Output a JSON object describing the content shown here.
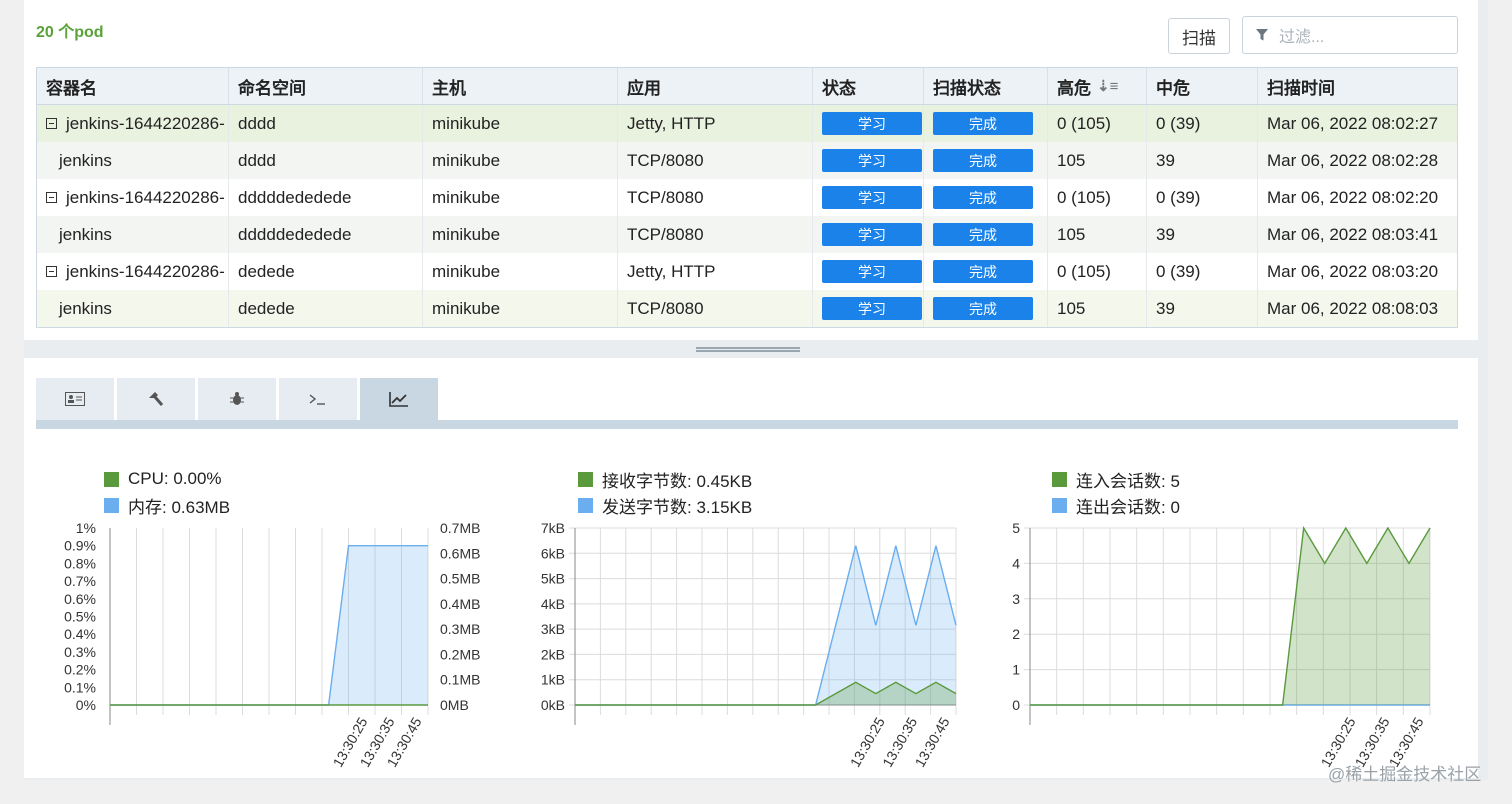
{
  "top": {
    "pod_count": "20 个pod",
    "scan_label": "扫描",
    "filter_placeholder": "过滤..."
  },
  "table": {
    "headers": [
      "容器名",
      "命名空间",
      "主机",
      "应用",
      "状态",
      "扫描状态",
      "高危",
      "中危",
      "扫描时间"
    ],
    "rows": [
      {
        "name": "jenkins-1644220286-",
        "ns": "dddd",
        "host": "minikube",
        "app": "Jetty, HTTP",
        "status": "学习",
        "scan": "完成",
        "high": "0 (105)",
        "mid": "0 (39)",
        "time": "Mar 06, 2022 08:02:27"
      },
      {
        "name": "jenkins",
        "ns": "dddd",
        "host": "minikube",
        "app": "TCP/8080",
        "status": "学习",
        "scan": "完成",
        "high": "105",
        "mid": "39",
        "time": "Mar 06, 2022 08:02:28"
      },
      {
        "name": "jenkins-1644220286-",
        "ns": "dddddededede",
        "host": "minikube",
        "app": "TCP/8080",
        "status": "学习",
        "scan": "完成",
        "high": "0 (105)",
        "mid": "0 (39)",
        "time": "Mar 06, 2022 08:02:20"
      },
      {
        "name": "jenkins",
        "ns": "dddddededede",
        "host": "minikube",
        "app": "TCP/8080",
        "status": "学习",
        "scan": "完成",
        "high": "105",
        "mid": "39",
        "time": "Mar 06, 2022 08:03:41"
      },
      {
        "name": "jenkins-1644220286-",
        "ns": "dedede",
        "host": "minikube",
        "app": "Jetty, HTTP",
        "status": "学习",
        "scan": "完成",
        "high": "0 (105)",
        "mid": "0 (39)",
        "time": "Mar 06, 2022 08:03:20"
      },
      {
        "name": "jenkins",
        "ns": "dedede",
        "host": "minikube",
        "app": "TCP/8080",
        "status": "学习",
        "scan": "完成",
        "high": "105",
        "mid": "39",
        "time": "Mar 06, 2022 08:08:03"
      }
    ]
  },
  "tabs": [
    "id-card-icon",
    "hammer-icon",
    "bug-icon",
    "terminal-icon",
    "chart-icon"
  ],
  "colors": {
    "green": "#5a9a3c",
    "blue": "#6aaef0",
    "tag": "#1a82e8"
  },
  "chart_data": [
    {
      "type": "area",
      "legend": [
        "CPU: 0.00%",
        "内存: 0.63MB"
      ],
      "x_ticks": [
        "13:30:25",
        "13:30:35",
        "13:30:45"
      ],
      "y_left_ticks": [
        "1%",
        "0.9%",
        "0.8%",
        "0.7%",
        "0.6%",
        "0.5%",
        "0.4%",
        "0.3%",
        "0.2%",
        "0.1%",
        "0%"
      ],
      "y_right_ticks": [
        "0.7MB",
        "0.6MB",
        "0.5MB",
        "0.4MB",
        "0.3MB",
        "0.2MB",
        "0.1MB",
        "0MB"
      ],
      "series": [
        {
          "name": "CPU",
          "values": [
            0,
            0,
            0,
            0,
            0,
            0,
            0,
            0,
            0,
            0,
            0,
            0,
            0,
            0,
            0,
            0,
            0
          ]
        },
        {
          "name": "内存",
          "values": [
            0,
            0,
            0,
            0,
            0,
            0,
            0,
            0,
            0,
            0,
            0,
            0,
            0.63,
            0.63,
            0.63,
            0.63,
            0.63
          ]
        }
      ],
      "ylim_left": [
        0,
        1
      ],
      "ylim_right": [
        0,
        0.7
      ]
    },
    {
      "type": "area",
      "legend": [
        "接收字节数: 0.45KB",
        "发送字节数: 3.15KB"
      ],
      "x_ticks": [
        "13:30:25",
        "13:30:35",
        "13:30:45"
      ],
      "y_ticks": [
        "7kB",
        "6kB",
        "5kB",
        "4kB",
        "3kB",
        "2kB",
        "1kB",
        "0kB"
      ],
      "series": [
        {
          "name": "接收字节数",
          "values": [
            0,
            0,
            0,
            0,
            0,
            0,
            0,
            0,
            0,
            0,
            0,
            0,
            0,
            0.45,
            0.9,
            0.45,
            0.9,
            0.45,
            0.9,
            0.45
          ]
        },
        {
          "name": "发送字节数",
          "values": [
            0,
            0,
            0,
            0,
            0,
            0,
            0,
            0,
            0,
            0,
            0,
            0,
            0,
            3.15,
            6.3,
            3.15,
            6.3,
            3.15,
            6.3,
            3.15
          ]
        }
      ],
      "ylim": [
        0,
        7
      ]
    },
    {
      "type": "area",
      "legend": [
        "连入会话数: 5",
        "连出会话数: 0"
      ],
      "x_ticks": [
        "13:30:25",
        "13:30:35",
        "13:30:45"
      ],
      "y_ticks": [
        "5",
        "4",
        "3",
        "2",
        "1",
        "0"
      ],
      "series": [
        {
          "name": "连入会话数",
          "values": [
            0,
            0,
            0,
            0,
            0,
            0,
            0,
            0,
            0,
            0,
            0,
            0,
            0,
            5,
            4,
            5,
            4,
            5,
            4,
            5
          ]
        },
        {
          "name": "连出会话数",
          "values": [
            0,
            0,
            0,
            0,
            0,
            0,
            0,
            0,
            0,
            0,
            0,
            0,
            0,
            0,
            0,
            0,
            0,
            0,
            0,
            0
          ]
        }
      ],
      "ylim": [
        0,
        5
      ]
    }
  ],
  "watermark": "@稀土掘金技术社区"
}
